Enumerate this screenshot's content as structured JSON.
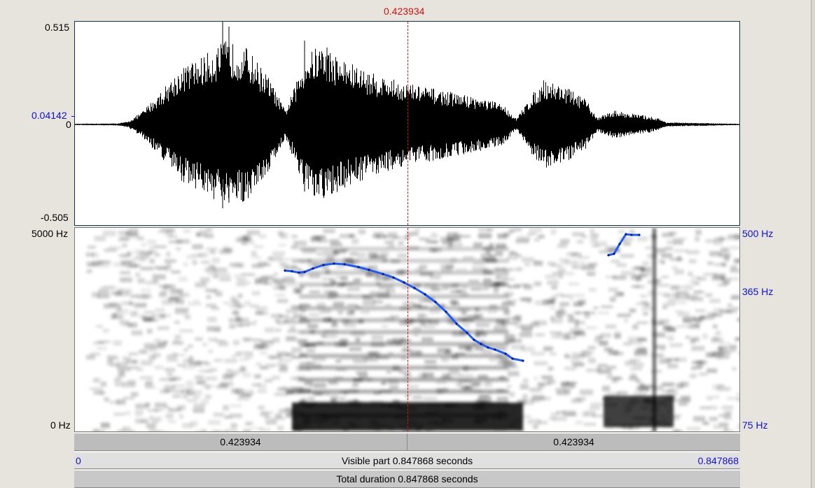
{
  "cursor": {
    "time": "0.423934"
  },
  "waveform": {
    "y_max": "0.515",
    "y_min": "-0.505",
    "y_zero": "0",
    "y_cursor_value": "0.04142"
  },
  "spectrogram": {
    "freq_top": "5000 Hz",
    "freq_bottom": "0 Hz",
    "pitch_top": "500 Hz",
    "pitch_mid": "365 Hz",
    "pitch_bottom": "75 Hz",
    "pitch_color": "#1e5cff"
  },
  "selection_bar": {
    "left_duration": "0.423934",
    "right_duration": "0.423934"
  },
  "visible_bar": {
    "start": "0",
    "label": "Visible part 0.847868 seconds",
    "end": "0.847868"
  },
  "total_bar": {
    "label": "Total duration 0.847868 seconds"
  }
}
